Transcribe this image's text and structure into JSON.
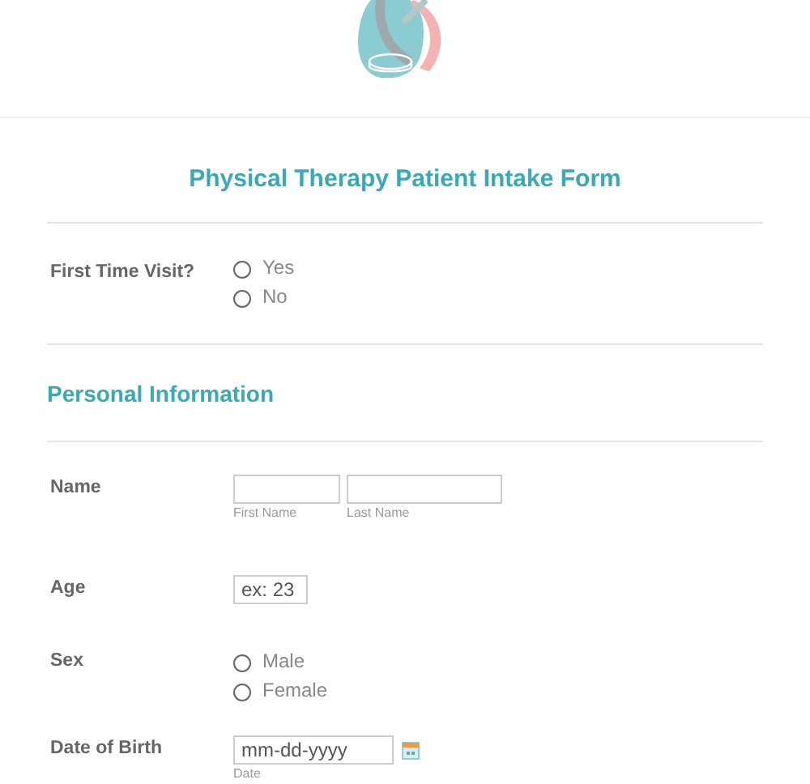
{
  "form_title": "Physical Therapy Patient Intake Form",
  "first_visit": {
    "label": "First Time Visit?",
    "options": [
      {
        "label": "Yes",
        "selected": false
      },
      {
        "label": "No",
        "selected": false
      }
    ]
  },
  "section": {
    "title": "Personal Information"
  },
  "fields": [
    {
      "kind": "name",
      "label": "Name",
      "inputs": [
        {
          "sublabel": "First Name"
        },
        {
          "sublabel": "Last Name"
        }
      ]
    },
    {
      "kind": "text",
      "label": "Age",
      "placeholder": "ex: 23"
    },
    {
      "kind": "radio",
      "label": "Sex",
      "options": [
        {
          "label": "Male",
          "selected": false
        },
        {
          "label": "Female",
          "selected": false
        }
      ]
    },
    {
      "kind": "date",
      "label": "Date of Birth",
      "placeholder": "mm-dd-yyyy",
      "sublabel": "Date"
    }
  ]
}
